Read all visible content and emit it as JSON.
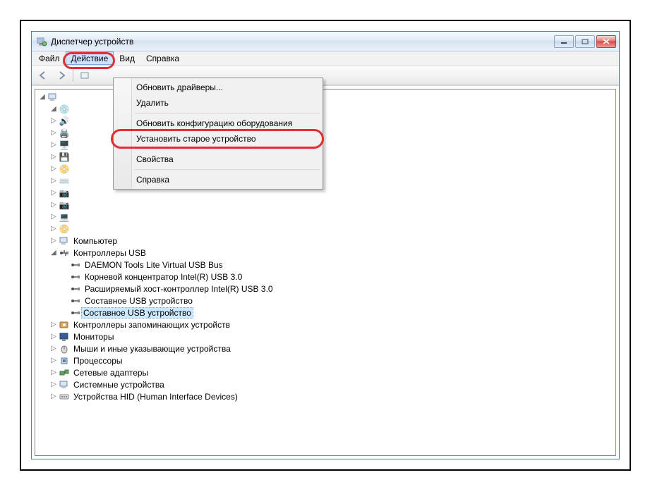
{
  "window": {
    "title": "Диспетчер устройств"
  },
  "menubar": {
    "file": "Файл",
    "action": "Действие",
    "view": "Вид",
    "help": "Справка"
  },
  "dropdown": {
    "update_drivers": "Обновить драйверы...",
    "delete": "Удалить",
    "rescan_hw": "Обновить конфигурацию оборудования",
    "add_legacy": "Установить старое устройство",
    "properties": "Свойства",
    "help": "Справка"
  },
  "tree": {
    "root_computer": "Компьютер",
    "usb_controllers": "Контроллеры USB",
    "usb_items": {
      "daemon": "DAEMON Tools Lite Virtual USB Bus",
      "root_hub": "Корневой концентратор Intel(R) USB 3.0",
      "xhci": "Расширяемый хост-контроллер Intel(R) USB 3.0",
      "composite1": "Составное USB устройство",
      "composite2": "Составное USB устройство"
    },
    "storage": "Контроллеры запоминающих устройств",
    "monitors": "Мониторы",
    "mice": "Мыши и иные указывающие устройства",
    "processors": "Процессоры",
    "network": "Сетевые адаптеры",
    "system": "Системные устройства",
    "hid": "Устройства HID (Human Interface Devices)"
  }
}
